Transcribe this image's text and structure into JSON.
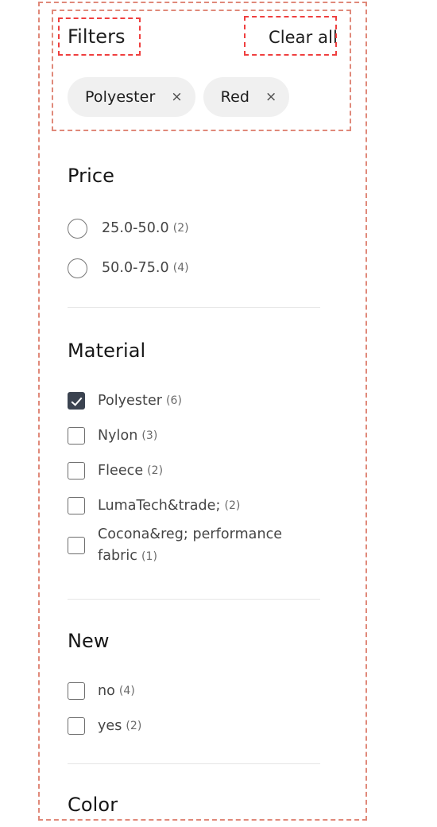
{
  "header": {
    "title": "Filters",
    "clear_all_label": "Clear all"
  },
  "active_filters": [
    {
      "label": "Polyester",
      "remove_icon": "close-icon",
      "remove_glyph": "×"
    },
    {
      "label": "Red",
      "remove_icon": "close-icon",
      "remove_glyph": "×"
    }
  ],
  "facets": [
    {
      "title": "Price",
      "control": "radio",
      "options": [
        {
          "label": "25.0-50.0",
          "count": "(2)",
          "selected": false
        },
        {
          "label": "50.0-75.0",
          "count": "(4)",
          "selected": false
        }
      ]
    },
    {
      "title": "Material",
      "control": "checkbox",
      "options": [
        {
          "label": "Polyester",
          "count": "(6)",
          "selected": true
        },
        {
          "label": "Nylon",
          "count": "(3)",
          "selected": false
        },
        {
          "label": "Fleece",
          "count": "(2)",
          "selected": false
        },
        {
          "label": "LumaTech&trade;",
          "count": "(2)",
          "selected": false
        },
        {
          "label": "Cocona&reg; performance fabric",
          "count": "(1)",
          "selected": false
        }
      ]
    },
    {
      "title": "New",
      "control": "checkbox",
      "options": [
        {
          "label": "no",
          "count": "(4)",
          "selected": false
        },
        {
          "label": "yes",
          "count": "(2)",
          "selected": false
        }
      ]
    },
    {
      "title": "Color",
      "control": "checkbox",
      "options": []
    }
  ],
  "annotations": {
    "outer_box_color": "#e0897a",
    "filters_section_box_color": "#e0897a",
    "filters_title_box_color": "#ef3f3f",
    "clear_all_box_color": "#ef3f3f"
  },
  "colors": {
    "chip_background": "#f0f0f0",
    "checkbox_checked": "#3b4350",
    "divider": "#e6e6e6",
    "heading_text": "#161616",
    "option_text": "#454545",
    "count_text": "#6b6b6b"
  }
}
